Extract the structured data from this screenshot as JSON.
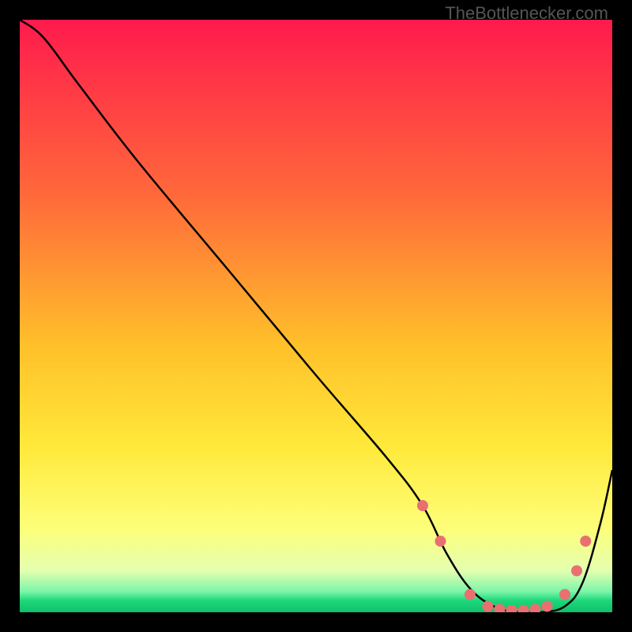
{
  "watermark": "TheBottlenecker.com",
  "chart_data": {
    "type": "line",
    "title": "",
    "xlabel": "",
    "ylabel": "",
    "xlim": [
      0,
      100
    ],
    "ylim": [
      0,
      100
    ],
    "gradient_stops": [
      {
        "offset": 0,
        "color": "#ff1a4d"
      },
      {
        "offset": 30,
        "color": "#ff6a3a"
      },
      {
        "offset": 55,
        "color": "#ffc02a"
      },
      {
        "offset": 72,
        "color": "#ffe93a"
      },
      {
        "offset": 86,
        "color": "#fdff7a"
      },
      {
        "offset": 93,
        "color": "#e4ffb0"
      },
      {
        "offset": 96.5,
        "color": "#7cf5a8"
      },
      {
        "offset": 98,
        "color": "#1fd87b"
      },
      {
        "offset": 100,
        "color": "#0fbf6a"
      }
    ],
    "series": [
      {
        "name": "bottleneck-curve",
        "x": [
          0,
          4,
          10,
          20,
          35,
          50,
          62,
          68,
          72,
          76,
          80,
          84,
          88,
          92,
          95,
          98,
          100
        ],
        "y": [
          100,
          97,
          89,
          76,
          58,
          40,
          26,
          18,
          10,
          4,
          1,
          0,
          0,
          1,
          5,
          15,
          24
        ]
      }
    ],
    "markers": {
      "name": "threshold-dots",
      "color": "#e97070",
      "points": [
        {
          "x": 68,
          "y": 18
        },
        {
          "x": 71,
          "y": 12
        },
        {
          "x": 76,
          "y": 3
        },
        {
          "x": 79,
          "y": 1
        },
        {
          "x": 81,
          "y": 0.5
        },
        {
          "x": 83,
          "y": 0.3
        },
        {
          "x": 85,
          "y": 0.3
        },
        {
          "x": 87,
          "y": 0.5
        },
        {
          "x": 89,
          "y": 1
        },
        {
          "x": 92,
          "y": 3
        },
        {
          "x": 94,
          "y": 7
        },
        {
          "x": 95.5,
          "y": 12
        }
      ]
    }
  }
}
